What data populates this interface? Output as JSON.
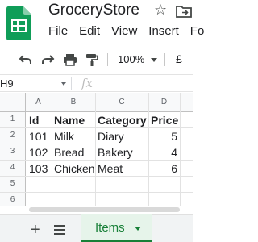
{
  "app": {
    "doc_title": "GroceryStore",
    "menu": [
      "File",
      "Edit",
      "View",
      "Insert",
      "Fo"
    ]
  },
  "toolbar": {
    "zoom": "100%",
    "currency": "£"
  },
  "formula_bar": {
    "name_box": "H9",
    "fx_label": "fx"
  },
  "grid": {
    "columns": [
      "A",
      "B",
      "C",
      "D"
    ],
    "row_numbers": [
      "1",
      "2",
      "3",
      "4",
      "5",
      "6"
    ],
    "cells": {
      "r1": [
        "Id",
        "Name",
        "Category",
        "Price"
      ],
      "r2": [
        "101",
        "Milk",
        "Diary",
        "5"
      ],
      "r3": [
        "102",
        "Bread",
        "Bakery",
        "4"
      ],
      "r4": [
        "103",
        "Chicken",
        "Meat",
        "6"
      ]
    }
  },
  "sheet_tabs": {
    "add": "+",
    "active": "Items"
  },
  "colors": {
    "brand_green": "#188038",
    "sheets_logo": "#0f9d58",
    "header_bg": "#f8f9fa"
  },
  "icons": [
    "sheets-logo-icon",
    "star-icon",
    "move-to-folder-icon",
    "undo-icon",
    "redo-icon",
    "print-icon",
    "paint-format-icon",
    "add-sheet-icon",
    "all-sheets-icon"
  ]
}
